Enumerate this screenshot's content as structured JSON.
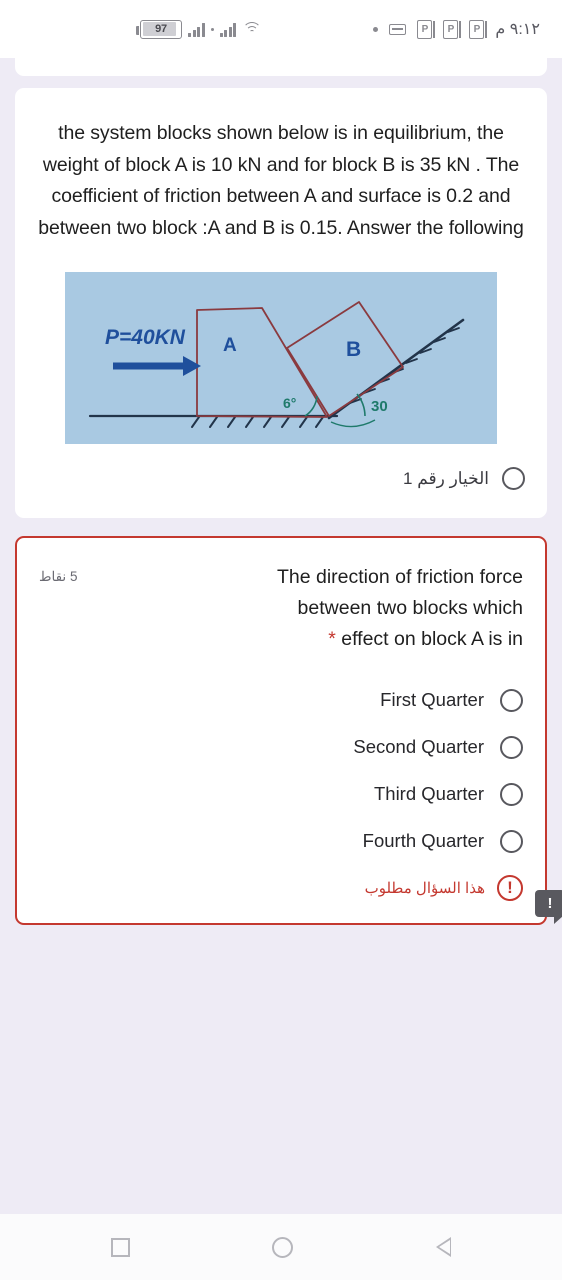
{
  "status_bar": {
    "battery_level": "97",
    "time": "٩:١٢ م",
    "icons": [
      "battery-icon",
      "signal-bars-icon",
      "signal-bars-icon",
      "wifi-icon",
      "dot-icon",
      "card-icon",
      "powerpoint-icon",
      "powerpoint-icon",
      "powerpoint-icon"
    ]
  },
  "question_1": {
    "text": "the system blocks shown below is in equilibrium, the weight of block A is 10 kN and for block B is 35 kN . The coefficient of friction between A and surface is 0.2 and between two block :A and B is 0.15. Answer the following",
    "diagram": {
      "background_color": "#a9c9e2",
      "force_label": "P=40KN",
      "block_a_label": "A",
      "block_b_label": "B",
      "angle_left": "6°",
      "angle_right": "30",
      "ink_blue": "#1f4f9c",
      "ink_green": "#1f7a6b",
      "ink_red": "#8a3a3f"
    },
    "option": {
      "label": "الخيار رقم 1",
      "selected": false
    }
  },
  "question_2": {
    "points": "5 نقاط",
    "title_line_1": "The direction of friction force",
    "title_line_2": "between two blocks which",
    "title_line_3": "effect on block A is in",
    "required_marker": "*",
    "options": [
      {
        "label": "First Quarter",
        "selected": false
      },
      {
        "label": "Second Quarter",
        "selected": false
      },
      {
        "label": "Third Quarter",
        "selected": false
      },
      {
        "label": "Fourth Quarter",
        "selected": false
      }
    ],
    "error_text": "هذا السؤال مطلوب",
    "error_icon": "exclamation-circle-icon",
    "tooltip_badge": "!",
    "border_color": "#c4382f"
  },
  "nav_bar": {
    "recents": "recents-square-icon",
    "home": "home-circle-icon",
    "back": "back-triangle-icon"
  },
  "theme": {
    "page_background": "#eeebf5",
    "card_background": "#ffffff",
    "error_color": "#c4382f"
  }
}
